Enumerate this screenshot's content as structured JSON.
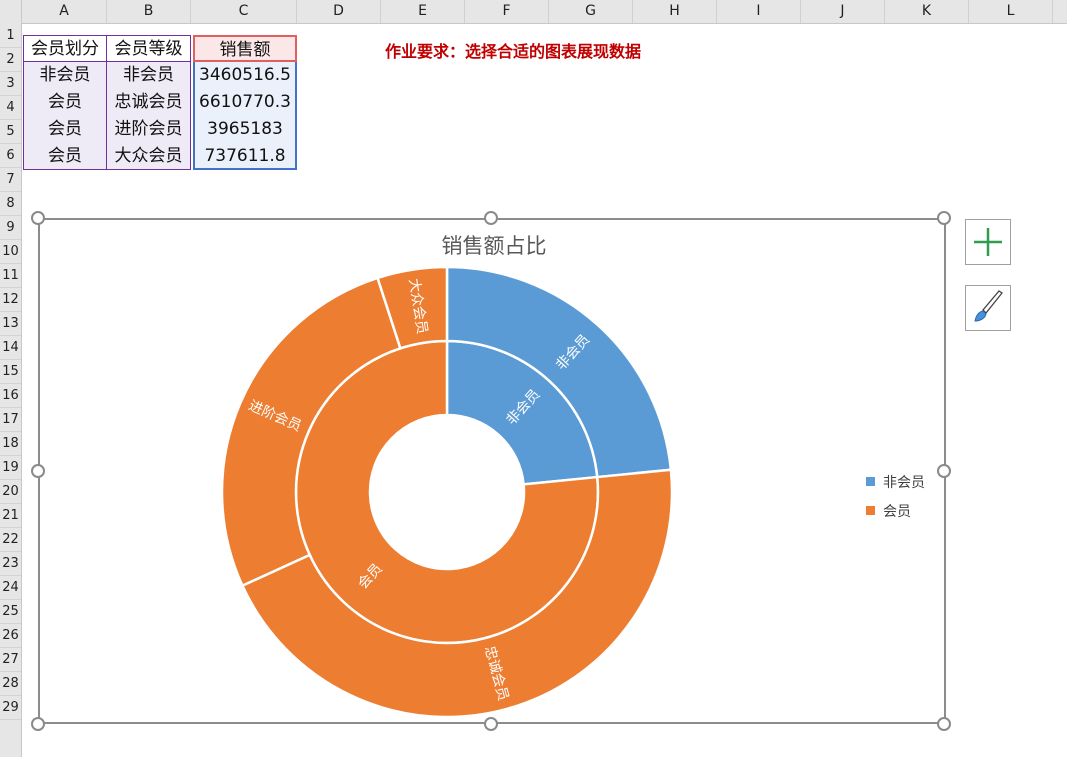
{
  "columns": [
    "A",
    "B",
    "C",
    "D",
    "E",
    "F",
    "G",
    "H",
    "I",
    "J",
    "K",
    "L"
  ],
  "rows": [
    "1",
    "2",
    "3",
    "4",
    "5",
    "6",
    "7",
    "8",
    "9",
    "10",
    "11",
    "12",
    "13",
    "14",
    "15",
    "16",
    "17",
    "18",
    "19",
    "20",
    "21",
    "22",
    "23",
    "24",
    "25",
    "26",
    "27",
    "28",
    "29"
  ],
  "table": {
    "headers": [
      "会员划分",
      "会员等级",
      "销售额"
    ],
    "rows": [
      [
        "非会员",
        "非会员",
        "3460516.5"
      ],
      [
        "会员",
        "忠诚会员",
        "6610770.3"
      ],
      [
        "会员",
        "进阶会员",
        "3965183"
      ],
      [
        "会员",
        "大众会员",
        "737611.8"
      ]
    ]
  },
  "note": "作业要求：选择合适的图表展现数据",
  "chart_data": {
    "type": "sunburst",
    "title": "销售额占比",
    "legend": [
      "非会员",
      "会员"
    ],
    "legend_position": "right",
    "colors": {
      "非会员": "#5b9bd5",
      "会员": "#ed7d31"
    },
    "inner": [
      {
        "label": "非会员",
        "value": 3460516.5
      },
      {
        "label": "会员",
        "value": 11313565.1
      }
    ],
    "outer": [
      {
        "label": "非会员",
        "parent": "非会员",
        "value": 3460516.5
      },
      {
        "label": "忠诚会员",
        "parent": "会员",
        "value": 6610770.3
      },
      {
        "label": "进阶会员",
        "parent": "会员",
        "value": 3965183
      },
      {
        "label": "大众会员",
        "parent": "会员",
        "value": 737611.8
      }
    ]
  },
  "buttons": {
    "chart_elements": "plus-icon",
    "chart_styles": "brush-icon"
  }
}
